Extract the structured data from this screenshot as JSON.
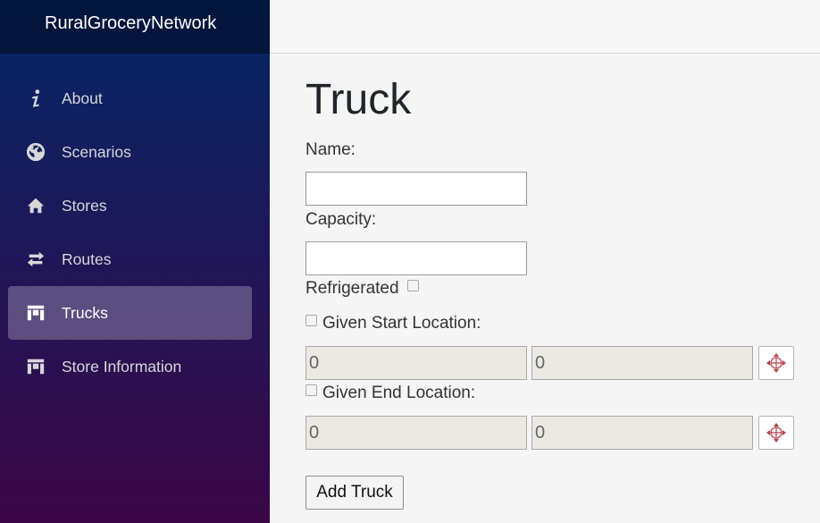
{
  "brand": "RuralGroceryNetwork",
  "nav": {
    "items": [
      {
        "label": "About",
        "icon": "info-icon"
      },
      {
        "label": "Scenarios",
        "icon": "globe-icon"
      },
      {
        "label": "Stores",
        "icon": "home-icon"
      },
      {
        "label": "Routes",
        "icon": "transfer-icon"
      },
      {
        "label": "Trucks",
        "icon": "dashboard-icon",
        "active": true
      },
      {
        "label": "Store Information",
        "icon": "dashboard-icon"
      }
    ]
  },
  "page": {
    "title": "Truck",
    "name_label": "Name:",
    "name_value": "",
    "capacity_label": "Capacity:",
    "capacity_value": "",
    "refrigerated_label": "Refrigerated",
    "refrigerated_checked": false,
    "start": {
      "label": "Given Start Location:",
      "checked": false,
      "x": "0",
      "y": "0",
      "pick_icon": "crosshair-icon"
    },
    "end": {
      "label": "Given End Location:",
      "checked": false,
      "x": "0",
      "y": "0",
      "pick_icon": "crosshair-icon"
    },
    "add_button": "Add Truck"
  }
}
